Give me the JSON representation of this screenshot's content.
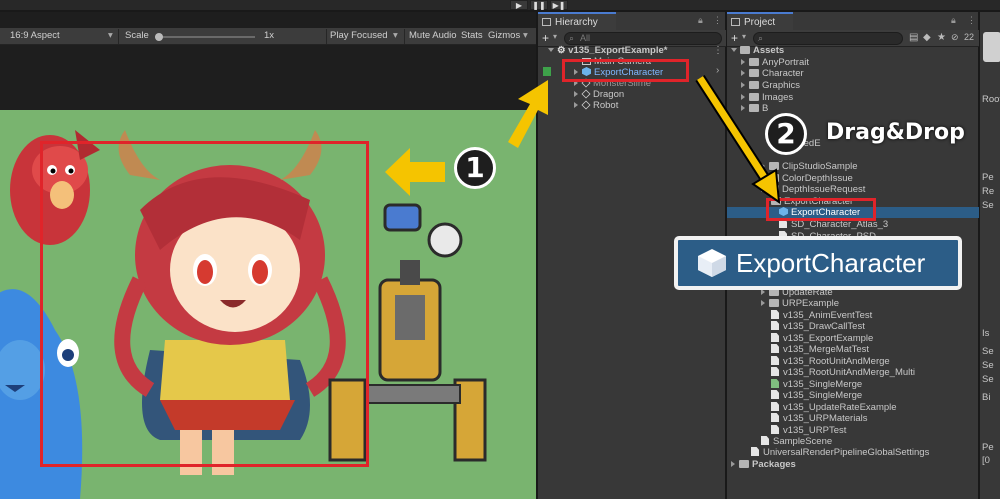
{
  "playbar": {
    "play": "▶",
    "pause": "❚❚",
    "step": "▶❚"
  },
  "game_toolbar": {
    "aspect": "16:9 Aspect",
    "scale_label": "Scale",
    "scale_value": "1x",
    "play_focused": "Play Focused",
    "mute_audio": "Mute Audio",
    "stats": "Stats",
    "gizmos": "Gizmos"
  },
  "hierarchy": {
    "tab_label": "Hierarchy",
    "search_placeholder": "All",
    "scene_name": "v135_ExportExample*",
    "items": [
      "Main Camera",
      "ExportCharacter",
      "MonsterSlime",
      "Dragon",
      "Robot"
    ]
  },
  "project": {
    "tab_label": "Project",
    "badge_count": "22",
    "assets_label": "Assets",
    "folders_top": [
      "AnyPortrait",
      "Character",
      "Graphics",
      "Images",
      "B"
    ],
    "folders_mid": [
      "tedE",
      "ClipStudioSample",
      "ColorDepthIssue",
      "DepthIssueRequest",
      "ExportCharacter"
    ],
    "selected_item": "ExportCharacter",
    "below_selected": [
      "SD_Character_Atlas_3",
      "SD_Character_PSD"
    ],
    "folders_bottom": [
      "UpdateRate",
      "URPExample"
    ],
    "scenes": [
      "v135_AnimEventTest",
      "v135_DrawCallTest",
      "v135_ExportExample",
      "v135_MergeMatTest",
      "v135_RootUnitAndMerge",
      "v135_RootUnitAndMerge_Multi",
      "v135_SingleMerge",
      "v135_SingleMerge",
      "v135_UpdateRateExample",
      "v135_URPMaterials",
      "v135_URPTest"
    ],
    "sample_scene": "SampleScene",
    "urp_settings": "UniversalRenderPipelineGlobalSettings",
    "packages_label": "Packages"
  },
  "annotations": {
    "step1": "1",
    "step2": "2",
    "drag_label": "Drag&Drop",
    "callout_text": "ExportCharacter"
  },
  "inspector_strip": [
    "Root",
    "Pe",
    "Re",
    "Se",
    "Is",
    "Se",
    "Se",
    "Se",
    "Bi",
    "Pe",
    "[0"
  ],
  "colors": {
    "accent_red": "#e0242a",
    "arrow_yellow": "#f5c400",
    "selection_blue": "#2c5d87",
    "game_bg": "#79b46f"
  }
}
